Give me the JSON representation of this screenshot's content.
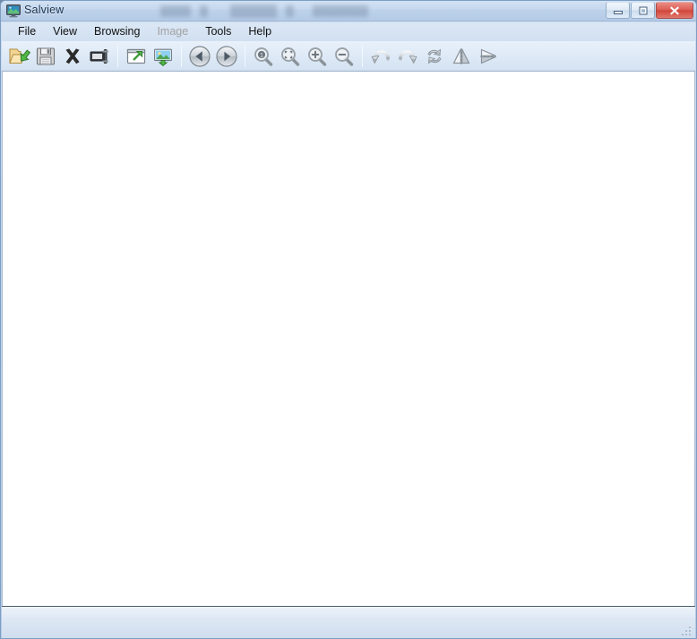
{
  "window": {
    "title": "Salview",
    "app_icon": "monitor-icon",
    "controls": [
      {
        "name": "minimize-button",
        "glyph": "minimize-icon",
        "label": "Minimize"
      },
      {
        "name": "maximize-button",
        "glyph": "maximize-icon",
        "label": "Maximize"
      },
      {
        "name": "close-button",
        "glyph": "close-icon",
        "label": "Close"
      }
    ],
    "colors": {
      "titlebar": "#c2d4ea",
      "close_button": "#cf4338",
      "canvas": "#ffffff",
      "frame_border": "#7c9ec4",
      "toolbar": "#dde9f6"
    }
  },
  "menubar": {
    "items": [
      {
        "label": "File",
        "name": "menu-file",
        "disabled": false
      },
      {
        "label": "View",
        "name": "menu-view",
        "disabled": false
      },
      {
        "label": "Browsing",
        "name": "menu-browsing",
        "disabled": false
      },
      {
        "label": "Image",
        "name": "menu-image",
        "disabled": true
      },
      {
        "label": "Tools",
        "name": "menu-tools",
        "disabled": false
      },
      {
        "label": "Help",
        "name": "menu-help",
        "disabled": false
      }
    ]
  },
  "toolbar": {
    "buttons": [
      {
        "name": "open-file-button",
        "icon": "open-folder-icon",
        "tooltip": "Open"
      },
      {
        "name": "save-button",
        "icon": "floppy-disk-icon",
        "tooltip": "Save"
      },
      {
        "name": "close-file-button",
        "icon": "close-x-icon",
        "tooltip": "Close"
      },
      {
        "name": "slideshow-button",
        "icon": "filmstrip-icon",
        "tooltip": "Slideshow"
      },
      {
        "name": "separator-1",
        "icon": "separator",
        "tooltip": ""
      },
      {
        "name": "open-external-button",
        "icon": "external-window-icon",
        "tooltip": "Open with external editor"
      },
      {
        "name": "set-wallpaper-button",
        "icon": "picture-download-icon",
        "tooltip": "Set as wallpaper"
      },
      {
        "name": "separator-2",
        "icon": "separator",
        "tooltip": ""
      },
      {
        "name": "previous-image-button",
        "icon": "arrow-left-circle-icon",
        "tooltip": "Previous"
      },
      {
        "name": "next-image-button",
        "icon": "arrow-right-circle-icon",
        "tooltip": "Next"
      },
      {
        "name": "separator-3",
        "icon": "separator",
        "tooltip": ""
      },
      {
        "name": "zoom-actual-size-button",
        "icon": "magnifier-one-icon",
        "tooltip": "Actual size"
      },
      {
        "name": "zoom-fit-button",
        "icon": "magnifier-fit-icon",
        "tooltip": "Fit to window"
      },
      {
        "name": "zoom-in-button",
        "icon": "magnifier-plus-icon",
        "tooltip": "Zoom in"
      },
      {
        "name": "zoom-out-button",
        "icon": "magnifier-minus-icon",
        "tooltip": "Zoom out"
      },
      {
        "name": "separator-4",
        "icon": "separator",
        "tooltip": ""
      },
      {
        "name": "rotate-left-button",
        "icon": "rotate-ccw-icon",
        "tooltip": "Rotate left"
      },
      {
        "name": "rotate-right-button",
        "icon": "rotate-cw-icon",
        "tooltip": "Rotate right"
      },
      {
        "name": "rotate-180-button",
        "icon": "refresh-circular-icon",
        "tooltip": "Rotate 180"
      },
      {
        "name": "flip-horizontal-button",
        "icon": "flip-horizontal-icon",
        "tooltip": "Flip horizontal"
      },
      {
        "name": "flip-vertical-button",
        "icon": "flip-vertical-icon",
        "tooltip": "Flip vertical"
      }
    ]
  },
  "content": {
    "empty": true,
    "message": ""
  },
  "statusbar": {
    "text": "",
    "resize_grip": "resize-grip-icon"
  }
}
